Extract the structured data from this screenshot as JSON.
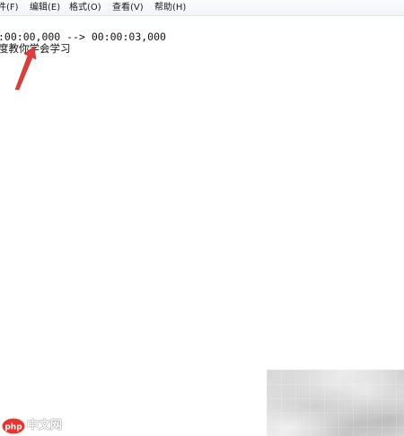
{
  "menubar": {
    "items": [
      {
        "label": "件(F)"
      },
      {
        "label": "编辑(E)"
      },
      {
        "label": "格式(O)"
      },
      {
        "label": "查看(V)"
      },
      {
        "label": "帮助(H)"
      }
    ]
  },
  "editor": {
    "lines": [
      ":00:00,000 --> 00:00:03,000",
      "度教你学会学习"
    ]
  },
  "annotation": {
    "arrow_color": "#e23b3b"
  },
  "watermark": {
    "logo_text": "php",
    "site_text": "中文网",
    "logo_color": "#e8332f"
  }
}
